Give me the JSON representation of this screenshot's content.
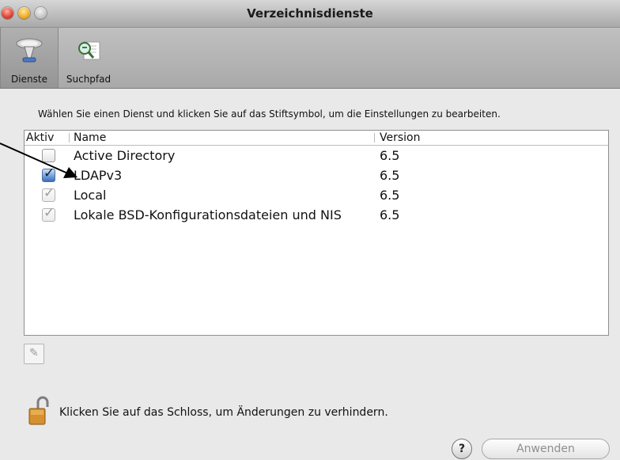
{
  "window": {
    "title": "Verzeichnisdienste"
  },
  "toolbar": {
    "items": [
      {
        "label": "Dienste",
        "icon": "directory-services-icon",
        "selected": true
      },
      {
        "label": "Suchpfad",
        "icon": "search-path-icon",
        "selected": false
      }
    ]
  },
  "main": {
    "instruction": "Wählen Sie einen Dienst und klicken Sie auf das Stiftsymbol, um die Einstellungen zu bearbeiten.",
    "table": {
      "columns": [
        "Aktiv",
        "Name",
        "Version"
      ],
      "rows": [
        {
          "active": "unchecked",
          "name": "Active Directory",
          "version": "6.5"
        },
        {
          "active": "checked",
          "name": "LDAPv3",
          "version": "6.5"
        },
        {
          "active": "checked-disabled",
          "name": "Local",
          "version": "6.5"
        },
        {
          "active": "checked-disabled",
          "name": "Lokale BSD-Konfigurationsdateien und NIS",
          "version": "6.5"
        }
      ]
    },
    "edit_icon": "pencil-icon"
  },
  "footer": {
    "lock_text": "Klicken Sie auf das Schloss, um Änderungen zu verhindern.",
    "help_label": "?",
    "apply_label": "Anwenden"
  },
  "colors": {
    "checkbox_blue": "#6f9bd9",
    "disabled_text": "#8f8f8f"
  }
}
